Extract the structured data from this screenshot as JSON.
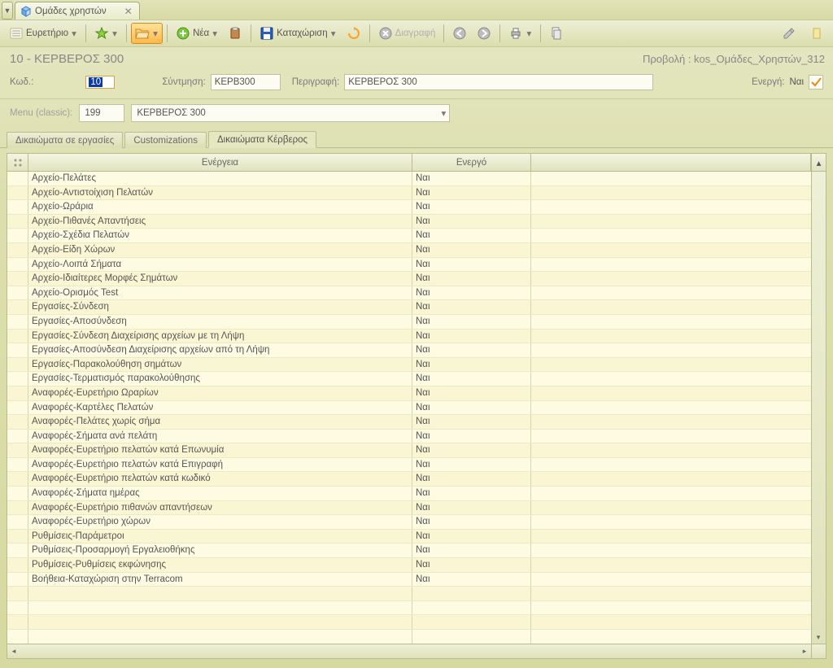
{
  "tab": {
    "title": "Ομάδες χρηστών"
  },
  "toolbar": {
    "index": "Ευρετήριο",
    "new": "Νέα",
    "save": "Καταχώριση",
    "delete": "Διαγραφή"
  },
  "header": {
    "title": "10 - ΚΕΡΒΕΡΟΣ 300",
    "view_label": "Προβολή : kos_Ομάδες_Χρηστών_312"
  },
  "form": {
    "code_label": "Κωδ.:",
    "code_value": "10",
    "abbr_label": "Σύντμηση:",
    "abbr_value": "ΚΕΡΒ300",
    "desc_label": "Περιγραφή:",
    "desc_value": "ΚΕΡΒΕΡΟΣ 300",
    "active_label": "Ενεργή:",
    "active_value": "Ναι"
  },
  "menu_line": {
    "label": "Menu (classic):",
    "code": "199",
    "desc": "ΚΕΡΒΕΡΟΣ 300"
  },
  "inner_tabs": {
    "t1": "Δικαιώματα σε εργασίες",
    "t2": "Customizations",
    "t3": "Δικαιώματα Κέρβερος"
  },
  "grid": {
    "col_action": "Ενέργεια",
    "col_active": "Ενεργό",
    "rows": [
      {
        "action": "Αρχείο-Πελάτες",
        "active": "Ναι"
      },
      {
        "action": "Αρχείο-Αντιστοίχιση Πελατών",
        "active": "Ναι"
      },
      {
        "action": "Αρχείο-Ωράρια",
        "active": "Ναι"
      },
      {
        "action": "Αρχείο-Πιθανές Απαντήσεις",
        "active": "Ναι"
      },
      {
        "action": "Αρχείο-Σχέδια Πελατών",
        "active": "Ναι"
      },
      {
        "action": "Αρχείο-Είδη Χώρων",
        "active": "Ναι"
      },
      {
        "action": "Αρχείο-Λοιπά Σήματα",
        "active": "Ναι"
      },
      {
        "action": "Αρχείο-Ιδιαίτερες Μορφές Σημάτων",
        "active": "Ναι"
      },
      {
        "action": "Αρχείο-Ορισμός Test",
        "active": "Ναι"
      },
      {
        "action": "Εργασίες-Σύνδεση",
        "active": "Ναι"
      },
      {
        "action": "Εργασίες-Αποσύνδεση",
        "active": "Ναι"
      },
      {
        "action": "Εργασίες-Σύνδεση Διαχείρισης αρχείων με τη Λήψη",
        "active": "Ναι"
      },
      {
        "action": "Εργασίες-Αποσύνδεση Διαχείρισης αρχείων από τη Λήψη",
        "active": "Ναι"
      },
      {
        "action": "Εργασίες-Παρακολούθηση σημάτων",
        "active": "Ναι"
      },
      {
        "action": "Εργασίες-Τερματισμός παρακολούθησης",
        "active": "Ναι"
      },
      {
        "action": "Αναφορές-Ευρετήριο Ωραρίων",
        "active": "Ναι"
      },
      {
        "action": "Αναφορές-Καρτέλες Πελατών",
        "active": "Ναι"
      },
      {
        "action": "Αναφορές-Πελάτες χωρίς σήμα",
        "active": "Ναι"
      },
      {
        "action": "Αναφορές-Σήματα ανά πελάτη",
        "active": "Ναι"
      },
      {
        "action": "Αναφορές-Ευρετήριο πελατών κατά Επωνυμία",
        "active": "Ναι"
      },
      {
        "action": "Αναφορές-Ευρετήριο πελατών κατά Επιγραφή",
        "active": "Ναι"
      },
      {
        "action": "Αναφορές-Ευρετήριο πελατών κατά κωδικό",
        "active": "Ναι"
      },
      {
        "action": "Αναφορές-Σήματα ημέρας",
        "active": "Ναι"
      },
      {
        "action": "Αναφορές-Ευρετήριο πιθανών απαντήσεων",
        "active": "Ναι"
      },
      {
        "action": "Αναφορές-Ευρετήριο χώρων",
        "active": "Ναι"
      },
      {
        "action": "Ρυθμίσεις-Παράμετροι",
        "active": "Ναι"
      },
      {
        "action": "Ρυθμίσεις-Προσαρμογή Εργαλειοθήκης",
        "active": "Ναι"
      },
      {
        "action": "Ρυθμίσεις-Ρυθμίσεις εκφώνησης",
        "active": "Ναι"
      },
      {
        "action": "Βοήθεια-Καταχώριση στην Terracom",
        "active": "Ναι"
      }
    ]
  }
}
